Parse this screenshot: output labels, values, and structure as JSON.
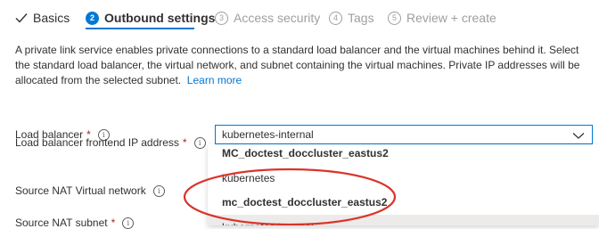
{
  "wizard": {
    "tabs": [
      {
        "label": "Basics",
        "state": "completed"
      },
      {
        "num": "2",
        "label": "Outbound settings",
        "state": "active"
      },
      {
        "num": "3",
        "label": "Access security",
        "state": "disabled"
      },
      {
        "num": "4",
        "label": "Tags",
        "state": "disabled"
      },
      {
        "num": "5",
        "label": "Review + create",
        "state": "disabled"
      }
    ]
  },
  "description": {
    "text": "A private link service enables private connections to a standard load balancer and the virtual machines behind it. Select the standard load balancer, the virtual network, and subnet containing the virtual machines. Private IP addresses will be allocated from the selected subnet.",
    "learn_more": "Learn more"
  },
  "form": {
    "load_balancer": {
      "label": "Load balancer",
      "required": "*",
      "value": "kubernetes-internal"
    },
    "frontend_ip": {
      "label": "Load balancer frontend IP address",
      "required": "*"
    },
    "nat_vnet": {
      "label": "Source NAT Virtual network"
    },
    "nat_subnet": {
      "label": "Source NAT subnet",
      "required": "*"
    }
  },
  "dropdown": {
    "options": [
      {
        "label": "MC_doctest_doccluster_eastus2",
        "group_header": true
      },
      {
        "label": "kubernetes"
      },
      {
        "label": "mc_doctest_doccluster_eastus2",
        "group_header": true
      },
      {
        "label": "kubernetes-internal",
        "selected": true
      }
    ]
  },
  "colors": {
    "accent": "#0078d4",
    "highlight_oval": "#d9352b",
    "required": "#a4262c"
  },
  "icons": {
    "info": "i",
    "chevron": "chevron-down-icon",
    "check": "check-icon"
  }
}
